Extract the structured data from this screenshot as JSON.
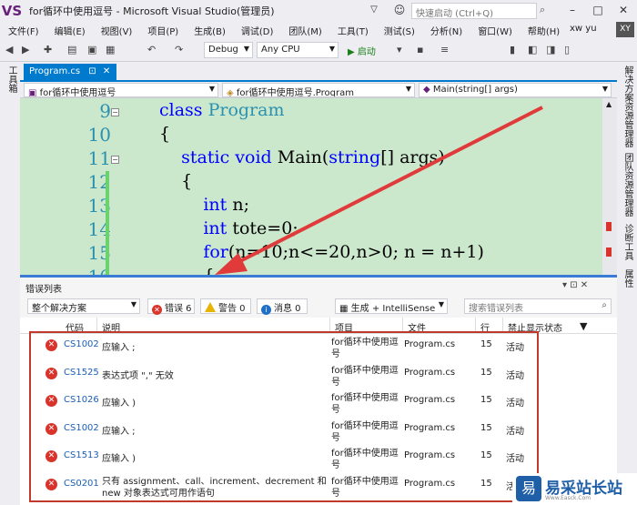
{
  "window": {
    "title": "for循环中使用逗号 - Microsoft Visual Studio(管理员)",
    "logo": "VS",
    "quick_launch_placeholder": "快速启动 (Ctrl+Q)",
    "minimize": "–",
    "restore": "□",
    "close": "✕"
  },
  "menu": [
    "文件(F)",
    "编辑(E)",
    "视图(V)",
    "项目(P)",
    "生成(B)",
    "调试(D)",
    "团队(M)",
    "工具(T)",
    "测试(S)",
    "分析(N)",
    "窗口(W)",
    "帮助(H)"
  ],
  "user": {
    "name": "xw yu",
    "initials": "XY"
  },
  "toolbar": {
    "config": "Debug",
    "platform": "Any CPU",
    "start": "▶ 启动"
  },
  "left_strip": {
    "label": "工具箱"
  },
  "right_strip": [
    "解决方案资源管理器",
    "团队资源管理器",
    "诊断工具",
    "属性"
  ],
  "doc_tab": {
    "label": "Program.cs",
    "pin": "⊡",
    "close": "✕"
  },
  "nav": {
    "project": "for循环中使用逗号",
    "class": "for循环中使用逗号.Program",
    "member": "Main(string[] args)"
  },
  "editor": {
    "lines": [
      {
        "num": "9",
        "indent": "",
        "parts": [
          {
            "t": "class ",
            "c": "kw"
          },
          {
            "t": "Program",
            "c": "ty"
          }
        ]
      },
      {
        "num": "10",
        "indent": "",
        "parts": [
          {
            "t": "{",
            "c": ""
          }
        ]
      },
      {
        "num": "11",
        "indent": "    ",
        "parts": [
          {
            "t": "static void ",
            "c": "kw"
          },
          {
            "t": "Main(",
            "c": ""
          },
          {
            "t": "string",
            "c": "kw"
          },
          {
            "t": "[] args)",
            "c": ""
          }
        ]
      },
      {
        "num": "12",
        "indent": "    ",
        "parts": [
          {
            "t": "{",
            "c": ""
          }
        ]
      },
      {
        "num": "13",
        "indent": "        ",
        "parts": [
          {
            "t": "int ",
            "c": "kw"
          },
          {
            "t": "n;",
            "c": ""
          }
        ]
      },
      {
        "num": "14",
        "indent": "        ",
        "parts": [
          {
            "t": "int ",
            "c": "kw"
          },
          {
            "t": "tote=0;",
            "c": ""
          }
        ]
      },
      {
        "num": "15",
        "indent": "        ",
        "parts": [
          {
            "t": "for",
            "c": "kw"
          },
          {
            "t": "(n=10;n<=20,n>0; n = n+1)",
            "c": ""
          }
        ]
      },
      {
        "num": "16",
        "indent": "        ",
        "parts": [
          {
            "t": "{",
            "c": ""
          }
        ]
      }
    ]
  },
  "error_list": {
    "title": "错误列表",
    "scope": "整个解决方案",
    "errors_label": "错误 6",
    "warnings_label": "警告 0",
    "messages_label": "消息 0",
    "build_filter": "生成 + IntelliSense",
    "search_placeholder": "搜索错误列表",
    "title_icons": "▾ ⊡ ✕",
    "columns": {
      "code": "代码",
      "description": "说明",
      "project": "项目",
      "file": "文件",
      "line": "行",
      "suppression": "禁止显示状态"
    },
    "rows": [
      {
        "code": "CS1002",
        "desc": "应输入 ;",
        "desc2": "",
        "project": "for循环中使用逗",
        "project2": "号",
        "file": "Program.cs",
        "line": "15",
        "state": "活动"
      },
      {
        "code": "CS1525",
        "desc": "表达式项 \",\" 无效",
        "desc2": "",
        "project": "for循环中使用逗",
        "project2": "号",
        "file": "Program.cs",
        "line": "15",
        "state": "活动"
      },
      {
        "code": "CS1026",
        "desc": "应输入 )",
        "desc2": "",
        "project": "for循环中使用逗",
        "project2": "号",
        "file": "Program.cs",
        "line": "15",
        "state": "活动"
      },
      {
        "code": "CS1002",
        "desc": "应输入 ;",
        "desc2": "",
        "project": "for循环中使用逗",
        "project2": "号",
        "file": "Program.cs",
        "line": "15",
        "state": "活动"
      },
      {
        "code": "CS1513",
        "desc": "应输入 )",
        "desc2": "",
        "project": "for循环中使用逗",
        "project2": "号",
        "file": "Program.cs",
        "line": "15",
        "state": "活动"
      },
      {
        "code": "CS0201",
        "desc": "只有 assignment、call、increment、decrement 和",
        "desc2": "new 对象表达式可用作语句",
        "project": "for循环中使用逗",
        "project2": "号",
        "file": "Program.cs",
        "line": "15",
        "state": "活"
      }
    ]
  },
  "watermark": {
    "logo": "易",
    "text": "易采站长站",
    "url": "Www.Easck.Com"
  },
  "colors": {
    "accent": "#007acc",
    "editor_bg": "#cbe8cd",
    "error": "#d9342b",
    "highlight": "#c0392b"
  }
}
